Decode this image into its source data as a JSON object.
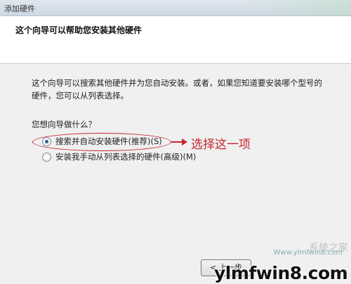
{
  "window": {
    "title": "添加硬件"
  },
  "header": {
    "heading": "这个向导可以帮助您安装其他硬件"
  },
  "content": {
    "intro": "这个向导可以搜索其他硬件并为您自动安装。或者，如果您知道要安装哪个型号的硬件，您可以从列表选择。",
    "question": "您想向导做什么？",
    "options": [
      {
        "label": "搜索并自动安装硬件(推荐)(S)",
        "selected": true
      },
      {
        "label": "安装我手动从列表选择的硬件(高级)(M)",
        "selected": false
      }
    ]
  },
  "annotation": {
    "text": "选择这一项",
    "color": "#c4262e"
  },
  "buttons": {
    "back": "< 上一步"
  },
  "watermark": {
    "brand": "ylmfwin8.com",
    "sub": "Www.ylmfwin8.com",
    "cn": "系统之家"
  }
}
